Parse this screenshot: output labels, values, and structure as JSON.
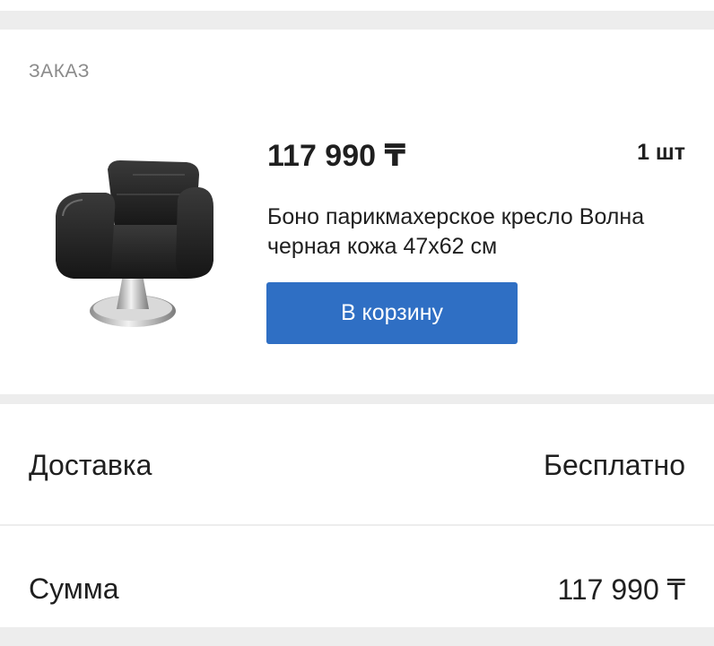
{
  "order": {
    "section_title": "ЗАКАЗ",
    "product": {
      "price": "117 990 ₸",
      "quantity": "1 шт",
      "name": "Боно парикмахерское кресло Волна черная кожа 47x62 см",
      "image_icon": "barber-chair-image"
    },
    "cart_button_label": "В корзину",
    "accent_color": "#2f6fc4"
  },
  "summary": {
    "delivery_label": "Доставка",
    "delivery_value": "Бесплатно",
    "total_label": "Сумма",
    "total_value": "117 990 ₸"
  }
}
